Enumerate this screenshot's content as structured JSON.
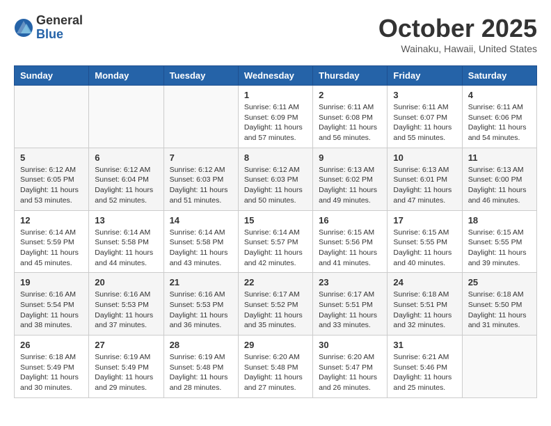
{
  "header": {
    "logo_general": "General",
    "logo_blue": "Blue",
    "month_title": "October 2025",
    "location": "Wainaku, Hawaii, United States"
  },
  "days_of_week": [
    "Sunday",
    "Monday",
    "Tuesday",
    "Wednesday",
    "Thursday",
    "Friday",
    "Saturday"
  ],
  "weeks": [
    {
      "days": [
        {
          "num": "",
          "info": ""
        },
        {
          "num": "",
          "info": ""
        },
        {
          "num": "",
          "info": ""
        },
        {
          "num": "1",
          "info": "Sunrise: 6:11 AM\nSunset: 6:09 PM\nDaylight: 11 hours\nand 57 minutes."
        },
        {
          "num": "2",
          "info": "Sunrise: 6:11 AM\nSunset: 6:08 PM\nDaylight: 11 hours\nand 56 minutes."
        },
        {
          "num": "3",
          "info": "Sunrise: 6:11 AM\nSunset: 6:07 PM\nDaylight: 11 hours\nand 55 minutes."
        },
        {
          "num": "4",
          "info": "Sunrise: 6:11 AM\nSunset: 6:06 PM\nDaylight: 11 hours\nand 54 minutes."
        }
      ]
    },
    {
      "days": [
        {
          "num": "5",
          "info": "Sunrise: 6:12 AM\nSunset: 6:05 PM\nDaylight: 11 hours\nand 53 minutes."
        },
        {
          "num": "6",
          "info": "Sunrise: 6:12 AM\nSunset: 6:04 PM\nDaylight: 11 hours\nand 52 minutes."
        },
        {
          "num": "7",
          "info": "Sunrise: 6:12 AM\nSunset: 6:03 PM\nDaylight: 11 hours\nand 51 minutes."
        },
        {
          "num": "8",
          "info": "Sunrise: 6:12 AM\nSunset: 6:03 PM\nDaylight: 11 hours\nand 50 minutes."
        },
        {
          "num": "9",
          "info": "Sunrise: 6:13 AM\nSunset: 6:02 PM\nDaylight: 11 hours\nand 49 minutes."
        },
        {
          "num": "10",
          "info": "Sunrise: 6:13 AM\nSunset: 6:01 PM\nDaylight: 11 hours\nand 47 minutes."
        },
        {
          "num": "11",
          "info": "Sunrise: 6:13 AM\nSunset: 6:00 PM\nDaylight: 11 hours\nand 46 minutes."
        }
      ]
    },
    {
      "days": [
        {
          "num": "12",
          "info": "Sunrise: 6:14 AM\nSunset: 5:59 PM\nDaylight: 11 hours\nand 45 minutes."
        },
        {
          "num": "13",
          "info": "Sunrise: 6:14 AM\nSunset: 5:58 PM\nDaylight: 11 hours\nand 44 minutes."
        },
        {
          "num": "14",
          "info": "Sunrise: 6:14 AM\nSunset: 5:58 PM\nDaylight: 11 hours\nand 43 minutes."
        },
        {
          "num": "15",
          "info": "Sunrise: 6:14 AM\nSunset: 5:57 PM\nDaylight: 11 hours\nand 42 minutes."
        },
        {
          "num": "16",
          "info": "Sunrise: 6:15 AM\nSunset: 5:56 PM\nDaylight: 11 hours\nand 41 minutes."
        },
        {
          "num": "17",
          "info": "Sunrise: 6:15 AM\nSunset: 5:55 PM\nDaylight: 11 hours\nand 40 minutes."
        },
        {
          "num": "18",
          "info": "Sunrise: 6:15 AM\nSunset: 5:55 PM\nDaylight: 11 hours\nand 39 minutes."
        }
      ]
    },
    {
      "days": [
        {
          "num": "19",
          "info": "Sunrise: 6:16 AM\nSunset: 5:54 PM\nDaylight: 11 hours\nand 38 minutes."
        },
        {
          "num": "20",
          "info": "Sunrise: 6:16 AM\nSunset: 5:53 PM\nDaylight: 11 hours\nand 37 minutes."
        },
        {
          "num": "21",
          "info": "Sunrise: 6:16 AM\nSunset: 5:53 PM\nDaylight: 11 hours\nand 36 minutes."
        },
        {
          "num": "22",
          "info": "Sunrise: 6:17 AM\nSunset: 5:52 PM\nDaylight: 11 hours\nand 35 minutes."
        },
        {
          "num": "23",
          "info": "Sunrise: 6:17 AM\nSunset: 5:51 PM\nDaylight: 11 hours\nand 33 minutes."
        },
        {
          "num": "24",
          "info": "Sunrise: 6:18 AM\nSunset: 5:51 PM\nDaylight: 11 hours\nand 32 minutes."
        },
        {
          "num": "25",
          "info": "Sunrise: 6:18 AM\nSunset: 5:50 PM\nDaylight: 11 hours\nand 31 minutes."
        }
      ]
    },
    {
      "days": [
        {
          "num": "26",
          "info": "Sunrise: 6:18 AM\nSunset: 5:49 PM\nDaylight: 11 hours\nand 30 minutes."
        },
        {
          "num": "27",
          "info": "Sunrise: 6:19 AM\nSunset: 5:49 PM\nDaylight: 11 hours\nand 29 minutes."
        },
        {
          "num": "28",
          "info": "Sunrise: 6:19 AM\nSunset: 5:48 PM\nDaylight: 11 hours\nand 28 minutes."
        },
        {
          "num": "29",
          "info": "Sunrise: 6:20 AM\nSunset: 5:48 PM\nDaylight: 11 hours\nand 27 minutes."
        },
        {
          "num": "30",
          "info": "Sunrise: 6:20 AM\nSunset: 5:47 PM\nDaylight: 11 hours\nand 26 minutes."
        },
        {
          "num": "31",
          "info": "Sunrise: 6:21 AM\nSunset: 5:46 PM\nDaylight: 11 hours\nand 25 minutes."
        },
        {
          "num": "",
          "info": ""
        }
      ]
    }
  ]
}
